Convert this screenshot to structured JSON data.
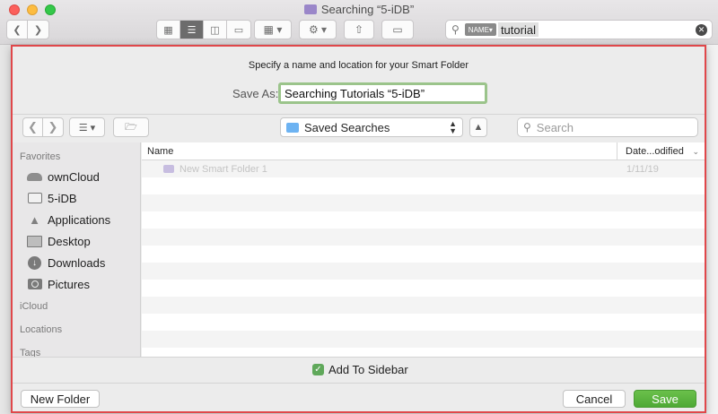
{
  "window": {
    "title": "Searching “5-iDB”",
    "search_token": "NAME",
    "search_value": "tutorial"
  },
  "sheet": {
    "prompt": "Specify a name and location for your Smart Folder",
    "save_as_label": "Save As:",
    "save_as_value": "Searching Tutorials “5-iDB”",
    "location": "Saved Searches",
    "search_placeholder": "Search"
  },
  "sidebar": {
    "favorites_header": "Favorites",
    "items": [
      {
        "label": "ownCloud",
        "icon": "cloud-icon"
      },
      {
        "label": "5-iDB",
        "icon": "folder-icon"
      },
      {
        "label": "Applications",
        "icon": "applications-icon"
      },
      {
        "label": "Desktop",
        "icon": "desktop-icon"
      },
      {
        "label": "Downloads",
        "icon": "downloads-icon"
      },
      {
        "label": "Pictures",
        "icon": "camera-icon"
      }
    ],
    "icloud_header": "iCloud",
    "locations_header": "Locations",
    "tags_header": "Tags"
  },
  "filelist": {
    "col_name": "Name",
    "col_date": "Date...odified",
    "rows": [
      {
        "name": "New Smart Folder 1",
        "date": "1/11/19"
      }
    ]
  },
  "footer": {
    "add_to_sidebar_label": "Add To Sidebar",
    "add_to_sidebar_checked": true,
    "new_folder_label": "New Folder",
    "cancel_label": "Cancel",
    "save_label": "Save"
  },
  "colors": {
    "highlight_border": "#e0474a",
    "save_button": "#5bb540",
    "input_focus": "#9bc48b"
  }
}
